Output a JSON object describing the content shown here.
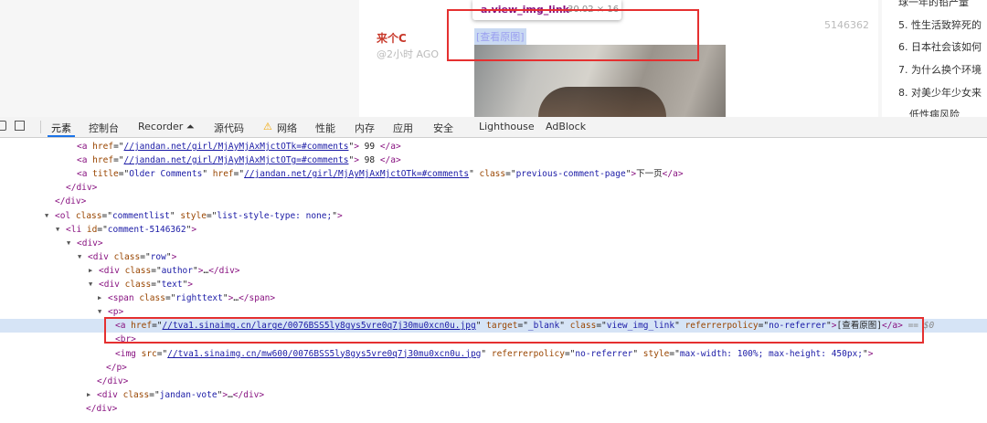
{
  "page": {
    "author": "来个C",
    "time": "@2小时 AGO",
    "comment_id": "5146362",
    "view_link_label": "[查看原图]",
    "tooltip": {
      "tag": "a.view_img_link",
      "dims": "30.02 × 16"
    },
    "sidebar": [
      {
        "label": "球一年的铅产量"
      },
      {
        "label": "5. 性生活致猝死的"
      },
      {
        "label": "6. 日本社会该如何"
      },
      {
        "label": "7. 为什么换个环境"
      },
      {
        "label": "8. 对美少年少女来"
      },
      {
        "label": "低性病风险"
      }
    ]
  },
  "devtools": {
    "tabs": [
      "元素",
      "控制台",
      "Recorder ⏶",
      "源代码",
      "网络",
      "性能",
      "内存",
      "应用",
      "安全",
      "Lighthouse",
      "AdBlock"
    ],
    "active_tab": "元素",
    "warning_icon": "warning-icon",
    "dom": [
      {
        "segs": [
          [
            "t",
            "<a "
          ],
          [
            "an",
            "href"
          ],
          [
            "eq",
            "=\""
          ],
          [
            "lk",
            "//jandan.net/girl/MjAyMjAxMjctOTk=#comments"
          ],
          [
            "eq",
            "\""
          ],
          [
            "t",
            ">"
          ],
          [
            "tx",
            " 99 "
          ],
          [
            "t",
            "</a>"
          ]
        ]
      },
      {
        "segs": [
          [
            "t",
            "<a "
          ],
          [
            "an",
            "href"
          ],
          [
            "eq",
            "=\""
          ],
          [
            "lk",
            "//jandan.net/girl/MjAyMjAxMjctOTg=#comments"
          ],
          [
            "eq",
            "\""
          ],
          [
            "t",
            ">"
          ],
          [
            "tx",
            " 98 "
          ],
          [
            "t",
            "</a>"
          ]
        ]
      },
      {
        "segs": [
          [
            "t",
            "<a "
          ],
          [
            "an",
            "title"
          ],
          [
            "eq",
            "=\""
          ],
          [
            "av",
            "Older Comments"
          ],
          [
            "eq",
            "\" "
          ],
          [
            "an",
            "href"
          ],
          [
            "eq",
            "=\""
          ],
          [
            "lk",
            "//jandan.net/girl/MjAyMjAxMjctOTk=#comments"
          ],
          [
            "eq",
            "\" "
          ],
          [
            "an",
            "class"
          ],
          [
            "eq",
            "=\""
          ],
          [
            "av",
            "previous-comment-page"
          ],
          [
            "eq",
            "\""
          ],
          [
            "t",
            ">"
          ],
          [
            "tx",
            "下一页"
          ],
          [
            "t",
            "</a>"
          ]
        ]
      },
      {
        "segs": [
          [
            "t",
            "</div>"
          ]
        ]
      },
      {
        "segs": [
          [
            "t",
            "</div>"
          ]
        ]
      },
      {
        "segs": [
          [
            "t",
            "<ol "
          ],
          [
            "an",
            "class"
          ],
          [
            "eq",
            "=\""
          ],
          [
            "av",
            "commentlist"
          ],
          [
            "eq",
            "\" "
          ],
          [
            "an",
            "style"
          ],
          [
            "eq",
            "=\""
          ],
          [
            "av",
            "list-style-type: none;"
          ],
          [
            "eq",
            "\""
          ],
          [
            "t",
            ">"
          ]
        ]
      },
      {
        "segs": [
          [
            "t",
            "<li "
          ],
          [
            "an",
            "id"
          ],
          [
            "eq",
            "=\""
          ],
          [
            "av",
            "comment-5146362"
          ],
          [
            "eq",
            "\""
          ],
          [
            "t",
            ">"
          ]
        ]
      },
      {
        "segs": [
          [
            "t",
            "<div>"
          ]
        ]
      },
      {
        "segs": [
          [
            "t",
            "<div "
          ],
          [
            "an",
            "class"
          ],
          [
            "eq",
            "=\""
          ],
          [
            "av",
            "row"
          ],
          [
            "eq",
            "\""
          ],
          [
            "t",
            ">"
          ]
        ]
      },
      {
        "segs": [
          [
            "t",
            "<div "
          ],
          [
            "an",
            "class"
          ],
          [
            "eq",
            "=\""
          ],
          [
            "av",
            "author"
          ],
          [
            "eq",
            "\""
          ],
          [
            "t",
            ">"
          ],
          [
            "tx",
            "…"
          ],
          [
            "t",
            "</div>"
          ]
        ]
      },
      {
        "segs": [
          [
            "t",
            "<div "
          ],
          [
            "an",
            "class"
          ],
          [
            "eq",
            "=\""
          ],
          [
            "av",
            "text"
          ],
          [
            "eq",
            "\""
          ],
          [
            "t",
            ">"
          ]
        ]
      },
      {
        "segs": [
          [
            "t",
            "<span "
          ],
          [
            "an",
            "class"
          ],
          [
            "eq",
            "=\""
          ],
          [
            "av",
            "righttext"
          ],
          [
            "eq",
            "\""
          ],
          [
            "t",
            ">"
          ],
          [
            "tx",
            "…"
          ],
          [
            "t",
            "</span>"
          ]
        ]
      },
      {
        "segs": [
          [
            "t",
            "<p>"
          ]
        ]
      },
      {
        "segs": [
          [
            "t",
            "<a "
          ],
          [
            "an",
            "href"
          ],
          [
            "eq",
            "=\""
          ],
          [
            "lk",
            "//tva1.sinaimg.cn/large/0076BSS5ly8gys5vre0q7j30mu0xcn0u.jpg"
          ],
          [
            "eq",
            "\" "
          ],
          [
            "an",
            "target"
          ],
          [
            "eq",
            "=\""
          ],
          [
            "av",
            "_blank"
          ],
          [
            "eq",
            "\" "
          ],
          [
            "an",
            "class"
          ],
          [
            "eq",
            "=\""
          ],
          [
            "av",
            "view_img_link"
          ],
          [
            "eq",
            "\" "
          ],
          [
            "an",
            "referrerpolicy"
          ],
          [
            "eq",
            "=\""
          ],
          [
            "av",
            "no-referrer"
          ],
          [
            "eq",
            "\""
          ],
          [
            "t",
            ">"
          ],
          [
            "tx",
            "[查看原图]"
          ],
          [
            "t",
            "</a>"
          ],
          [
            "dollar",
            " == $0"
          ]
        ]
      },
      {
        "segs": [
          [
            "t",
            "<br>"
          ]
        ]
      },
      {
        "segs": [
          [
            "t",
            "<img "
          ],
          [
            "an",
            "src"
          ],
          [
            "eq",
            "=\""
          ],
          [
            "lk",
            "//tva1.sinaimg.cn/mw600/0076BSS5ly8gys5vre0q7j30mu0xcn0u.jpg"
          ],
          [
            "eq",
            "\" "
          ],
          [
            "an",
            "referrerpolicy"
          ],
          [
            "eq",
            "=\""
          ],
          [
            "av",
            "no-referrer"
          ],
          [
            "eq",
            "\" "
          ],
          [
            "an",
            "style"
          ],
          [
            "eq",
            "=\""
          ],
          [
            "av",
            "max-width: 100%; max-height: 450px;"
          ],
          [
            "eq",
            "\""
          ],
          [
            "t",
            ">"
          ]
        ]
      },
      {
        "segs": [
          [
            "t",
            "</p>"
          ]
        ]
      },
      {
        "segs": [
          [
            "t",
            "</div>"
          ]
        ]
      },
      {
        "segs": [
          [
            "t",
            "<div "
          ],
          [
            "an",
            "class"
          ],
          [
            "eq",
            "=\""
          ],
          [
            "av",
            "jandan-vote"
          ],
          [
            "eq",
            "\""
          ],
          [
            "t",
            ">"
          ],
          [
            "tx",
            "…"
          ],
          [
            "t",
            "</div>"
          ]
        ]
      },
      {
        "segs": [
          [
            "t",
            "</div>"
          ]
        ]
      }
    ]
  }
}
